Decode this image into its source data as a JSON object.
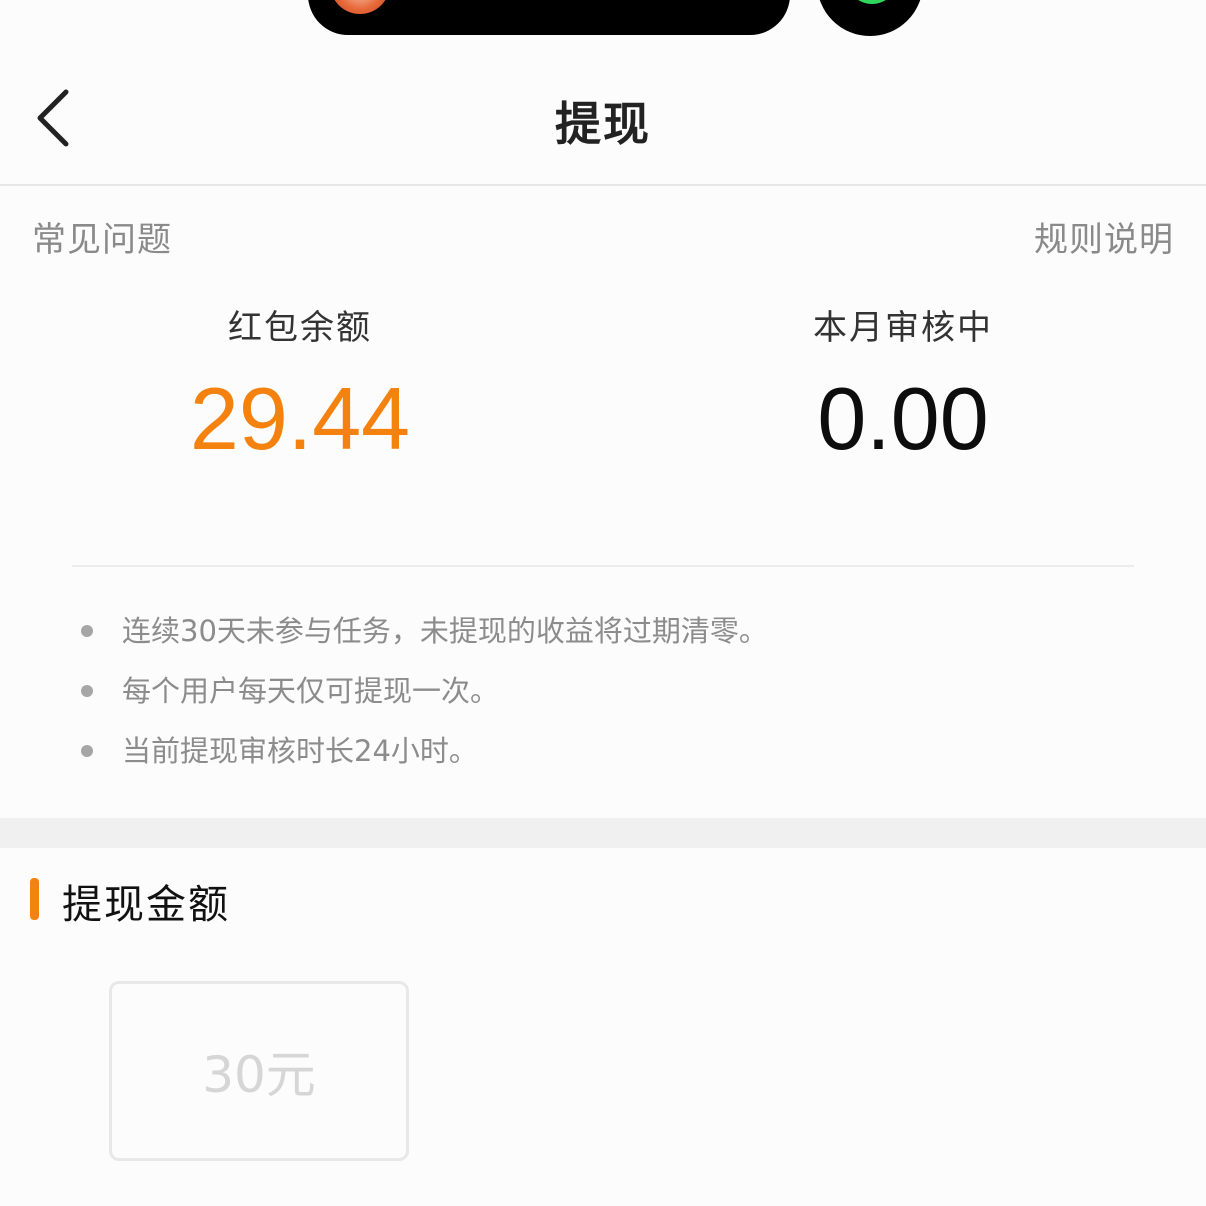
{
  "header": {
    "title": "提现",
    "back_icon": "chevron-left-icon"
  },
  "links": {
    "faq": "常见问题",
    "rules": "规则说明"
  },
  "stats": {
    "balance_label": "红包余额",
    "balance_value": "29.44",
    "reviewing_label": "本月审核中",
    "reviewing_value": "0.00"
  },
  "notes": [
    "连续30天未参与任务，未提现的收益将过期清零。",
    "每个用户每天仅可提现一次。",
    "当前提现审核时长24小时。"
  ],
  "withdraw": {
    "section_title": "提现金额",
    "options": [
      "30元"
    ]
  },
  "colors": {
    "accent": "#f5820f",
    "muted_text": "#8c8c8c",
    "disabled_text": "#d6d6d6"
  }
}
